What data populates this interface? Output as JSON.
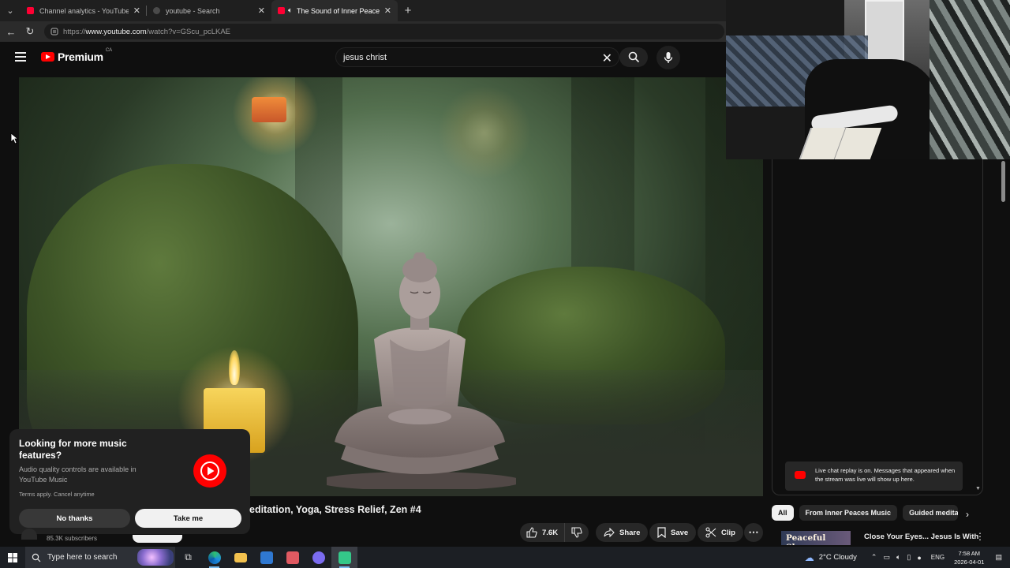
{
  "browser": {
    "tabs": [
      {
        "title": "Channel analytics - YouTube Studio",
        "favicon_color": "#ff0033"
      },
      {
        "title": "youtube - Search",
        "favicon_color": "#888888"
      },
      {
        "title": "The Sound of Inner Peace | Relax",
        "favicon_color": "#ff0033"
      }
    ],
    "url_prefix": "https://",
    "url_host": "www.youtube.com",
    "url_path": "/watch?v=GScu_pcLKAE"
  },
  "masthead": {
    "brand": "Premium",
    "region": "CA",
    "search_value": "jesus christ"
  },
  "popup": {
    "title": "Looking for more music features?",
    "body": "Audio quality controls are available in YouTube Music",
    "terms": "Terms apply. Cancel anytime",
    "no_label": "No thanks",
    "yes_label": "Take me"
  },
  "video": {
    "title_visible": "editation, Yoga, Stress Relief, Zen #4",
    "subscribers": "85.3K subscribers",
    "likes": "7.6K",
    "share_label": "Share",
    "save_label": "Save",
    "clip_label": "Clip"
  },
  "chat": {
    "replay_note": "Live chat replay is on. Messages that appeared when the stream was live will show up here."
  },
  "chips": [
    {
      "label": "All",
      "active": true
    },
    {
      "label": "From Inner Peaces Music",
      "active": false
    },
    {
      "label": "Guided meditat",
      "active": false
    }
  ],
  "recommendation": {
    "thumb_text": "Peaceful Sleep.",
    "title": "Close Your Eyes... Jesus Is With"
  },
  "taskbar": {
    "search_placeholder": "Type here to search",
    "weather": "2°C  Cloudy",
    "language": "ENG",
    "time": "7:58 AM",
    "date": "2026-04-01"
  },
  "colors": {
    "accent_red": "#ff0000",
    "background": "#0f0f0f"
  }
}
